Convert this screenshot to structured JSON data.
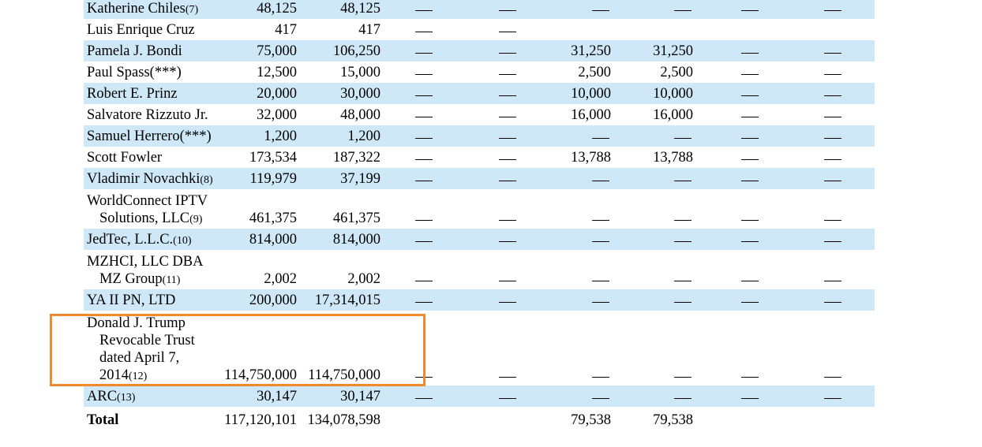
{
  "rows": [
    {
      "name": [
        "Katherine Chiles"
      ],
      "note": "(7)",
      "c1": "48,125",
      "c2": "48,125",
      "c3": "—",
      "c4": "—",
      "c5": "—",
      "c6": "—",
      "c7": "—",
      "c8": "—",
      "shade": true
    },
    {
      "name": [
        "Luis Enrique Cruz"
      ],
      "note": "",
      "c1": "417",
      "c2": "417",
      "c3": "—",
      "c4": "—",
      "c5": "",
      "c6": "",
      "c7": "",
      "c8": "",
      "shade": false
    },
    {
      "name": [
        "Pamela J. Bondi"
      ],
      "note": "",
      "c1": "75,000",
      "c2": "106,250",
      "c3": "—",
      "c4": "—",
      "c5": "31,250",
      "c6": "31,250",
      "c7": "—",
      "c8": "—",
      "shade": true
    },
    {
      "name": [
        "Paul Spass(***)"
      ],
      "note": "",
      "c1": "12,500",
      "c2": "15,000",
      "c3": "—",
      "c4": "—",
      "c5": "2,500",
      "c6": "2,500",
      "c7": "—",
      "c8": "—",
      "shade": false
    },
    {
      "name": [
        "Robert E. Prinz"
      ],
      "note": "",
      "c1": "20,000",
      "c2": "30,000",
      "c3": "—",
      "c4": "—",
      "c5": "10,000",
      "c6": "10,000",
      "c7": "—",
      "c8": "—",
      "shade": true
    },
    {
      "name": [
        "Salvatore Rizzuto Jr."
      ],
      "note": "",
      "c1": "32,000",
      "c2": "48,000",
      "c3": "—",
      "c4": "—",
      "c5": "16,000",
      "c6": "16,000",
      "c7": "—",
      "c8": "—",
      "shade": false
    },
    {
      "name": [
        "Samuel Herrero(***)"
      ],
      "note": "",
      "c1": "1,200",
      "c2": "1,200",
      "c3": "—",
      "c4": "—",
      "c5": "—",
      "c6": "—",
      "c7": "—",
      "c8": "—",
      "shade": true
    },
    {
      "name": [
        "Scott Fowler"
      ],
      "note": "",
      "c1": "173,534",
      "c2": "187,322",
      "c3": "—",
      "c4": "—",
      "c5": "13,788",
      "c6": "13,788",
      "c7": "—",
      "c8": "—",
      "shade": false
    },
    {
      "name": [
        "Vladimir Novachki"
      ],
      "note": "(8)",
      "c1": "119,979",
      "c2": "37,199",
      "c3": "—",
      "c4": "—",
      "c5": "—",
      "c6": "—",
      "c7": "—",
      "c8": "—",
      "shade": true
    },
    {
      "name": [
        "WorldConnect IPTV",
        "Solutions, LLC"
      ],
      "note": "(9)",
      "c1": "461,375",
      "c2": "461,375",
      "c3": "—",
      "c4": "—",
      "c5": "—",
      "c6": "—",
      "c7": "—",
      "c8": "—",
      "shade": false
    },
    {
      "name": [
        "JedTec, L.L.C."
      ],
      "note": "(10)",
      "c1": "814,000",
      "c2": "814,000",
      "c3": "—",
      "c4": "—",
      "c5": "—",
      "c6": "—",
      "c7": "—",
      "c8": "—",
      "shade": true
    },
    {
      "name": [
        "MZHCI, LLC DBA",
        "MZ Group"
      ],
      "note": "(11)",
      "c1": "2,002",
      "c2": "2,002",
      "c3": "—",
      "c4": "—",
      "c5": "—",
      "c6": "—",
      "c7": "—",
      "c8": "—",
      "shade": false
    },
    {
      "name": [
        "YA II PN, LTD"
      ],
      "note": "",
      "c1": "200,000",
      "c2": "17,314,015",
      "c3": "—",
      "c4": "—",
      "c5": "—",
      "c6": "—",
      "c7": "—",
      "c8": "—",
      "shade": true
    },
    {
      "name": [
        "Donald J. Trump",
        "Revocable Trust",
        "dated April 7,",
        "2014"
      ],
      "note": "(12)",
      "c1": "114,750,000",
      "c2": "114,750,000",
      "c3": "—",
      "c4": "—",
      "c5": "—",
      "c6": "—",
      "c7": "—",
      "c8": "—",
      "shade": false
    },
    {
      "name": [
        "ARC"
      ],
      "note": "(13)",
      "c1": "30,147",
      "c2": "30,147",
      "c3": "—",
      "c4": "—",
      "c5": "—",
      "c6": "—",
      "c7": "—",
      "c8": "—",
      "shade": true
    },
    {
      "name": [
        "Total"
      ],
      "note": "",
      "c1": "117,120,101",
      "c2": "134,078,598",
      "c3": "",
      "c4": "",
      "c5": "79,538",
      "c6": "79,538",
      "c7": "",
      "c8": "",
      "shade": false,
      "bold": true
    }
  ],
  "colors": {
    "shade": "#cfe8f7",
    "highlight": "#f28a2d"
  }
}
